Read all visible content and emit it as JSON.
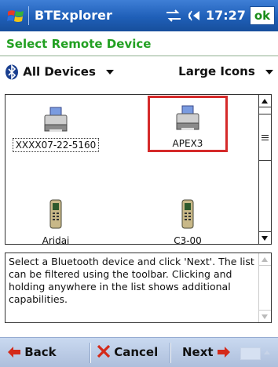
{
  "titlebar": {
    "app_title": "BTExplorer",
    "clock": "17:27",
    "ok_label": "ok"
  },
  "heading": "Select Remote Device",
  "toolbar": {
    "device_filter": "All Devices",
    "view_mode": "Large Icons"
  },
  "devices": [
    {
      "label": "XXXX07-22-5160",
      "type": "printer"
    },
    {
      "label": "APEX3",
      "type": "printer"
    },
    {
      "label": "Aridai",
      "type": "phone"
    },
    {
      "label": "C3-00",
      "type": "phone"
    }
  ],
  "help_text": "Select a Bluetooth device and click 'Next'. The list can be filtered using the toolbar. Clicking and holding anywhere in the list shows additional capabilities.",
  "menubar": {
    "back": "Back",
    "cancel": "Cancel",
    "next": "Next"
  },
  "colors": {
    "title_bar": "#1f5fb8",
    "heading_text": "#22a022",
    "selection": "#d52a2a",
    "menubar": "#bccde8"
  }
}
